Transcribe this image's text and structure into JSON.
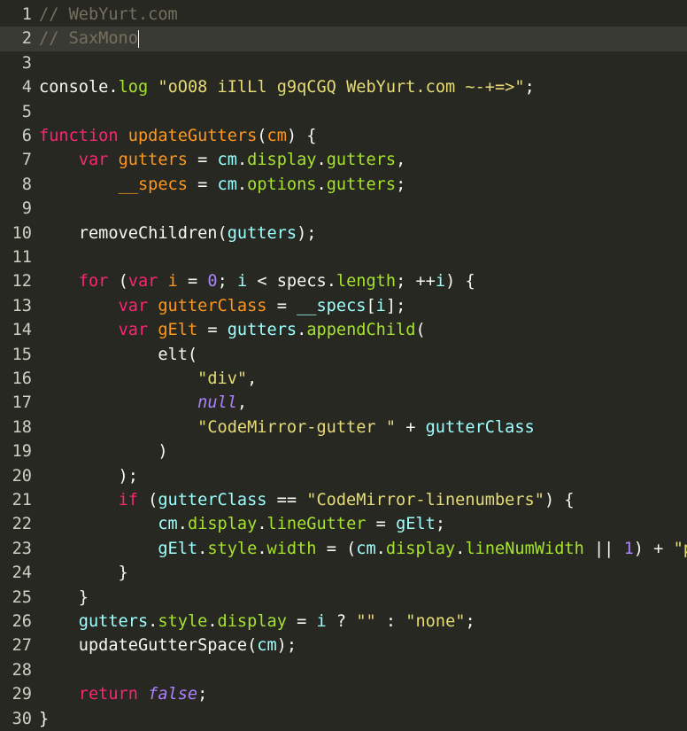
{
  "editor": {
    "lines": [
      {
        "n": "1",
        "tokens": [
          {
            "t": "// WebYurt.com",
            "c": "cmt"
          }
        ]
      },
      {
        "n": "2",
        "tokens": [
          {
            "t": "// SaxMono",
            "c": "cmt"
          }
        ],
        "active": true
      },
      {
        "n": "3",
        "tokens": []
      },
      {
        "n": "4",
        "tokens": [
          {
            "t": "console",
            "c": ""
          },
          {
            "t": ".",
            "c": ""
          },
          {
            "t": "log",
            "c": "prop"
          },
          {
            "t": " ",
            "c": ""
          },
          {
            "t": "\"oO08 iIlLl g9qCGQ WebYurt.com ~-+=>\"",
            "c": "str"
          },
          {
            "t": ";",
            "c": ""
          }
        ]
      },
      {
        "n": "5",
        "tokens": []
      },
      {
        "n": "6",
        "tokens": [
          {
            "t": "function",
            "c": "kw"
          },
          {
            "t": " ",
            "c": ""
          },
          {
            "t": "updateGutters",
            "c": "def"
          },
          {
            "t": "(",
            "c": ""
          },
          {
            "t": "cm",
            "c": "def"
          },
          {
            "t": ") {",
            "c": ""
          }
        ]
      },
      {
        "n": "7",
        "tokens": [
          {
            "t": "    ",
            "c": ""
          },
          {
            "t": "var",
            "c": "kw"
          },
          {
            "t": " ",
            "c": ""
          },
          {
            "t": "gutters",
            "c": "def"
          },
          {
            "t": " = ",
            "c": ""
          },
          {
            "t": "cm",
            "c": "var2"
          },
          {
            "t": ".",
            "c": ""
          },
          {
            "t": "display",
            "c": "prop"
          },
          {
            "t": ".",
            "c": ""
          },
          {
            "t": "gutters",
            "c": "prop"
          },
          {
            "t": ",",
            "c": ""
          }
        ]
      },
      {
        "n": "8",
        "tokens": [
          {
            "t": "        ",
            "c": ""
          },
          {
            "t": "__specs",
            "c": "def"
          },
          {
            "t": " = ",
            "c": ""
          },
          {
            "t": "cm",
            "c": "var2"
          },
          {
            "t": ".",
            "c": ""
          },
          {
            "t": "options",
            "c": "prop"
          },
          {
            "t": ".",
            "c": ""
          },
          {
            "t": "gutters",
            "c": "prop"
          },
          {
            "t": ";",
            "c": ""
          }
        ]
      },
      {
        "n": "9",
        "tokens": []
      },
      {
        "n": "10",
        "tokens": [
          {
            "t": "    removeChildren(",
            "c": ""
          },
          {
            "t": "gutters",
            "c": "var2"
          },
          {
            "t": ");",
            "c": ""
          }
        ]
      },
      {
        "n": "11",
        "tokens": []
      },
      {
        "n": "12",
        "tokens": [
          {
            "t": "    ",
            "c": ""
          },
          {
            "t": "for",
            "c": "kw"
          },
          {
            "t": " (",
            "c": ""
          },
          {
            "t": "var",
            "c": "kw"
          },
          {
            "t": " ",
            "c": ""
          },
          {
            "t": "i",
            "c": "def"
          },
          {
            "t": " = ",
            "c": ""
          },
          {
            "t": "0",
            "c": "num"
          },
          {
            "t": "; ",
            "c": ""
          },
          {
            "t": "i",
            "c": "var2"
          },
          {
            "t": " < specs.",
            "c": ""
          },
          {
            "t": "length",
            "c": "prop"
          },
          {
            "t": "; ++",
            "c": ""
          },
          {
            "t": "i",
            "c": "var2"
          },
          {
            "t": ") {",
            "c": ""
          }
        ]
      },
      {
        "n": "13",
        "tokens": [
          {
            "t": "        ",
            "c": ""
          },
          {
            "t": "var",
            "c": "kw"
          },
          {
            "t": " ",
            "c": ""
          },
          {
            "t": "gutterClass",
            "c": "def"
          },
          {
            "t": " = ",
            "c": ""
          },
          {
            "t": "__specs",
            "c": "var2"
          },
          {
            "t": "[",
            "c": ""
          },
          {
            "t": "i",
            "c": "var2"
          },
          {
            "t": "];",
            "c": ""
          }
        ]
      },
      {
        "n": "14",
        "tokens": [
          {
            "t": "        ",
            "c": ""
          },
          {
            "t": "var",
            "c": "kw"
          },
          {
            "t": " ",
            "c": ""
          },
          {
            "t": "gElt",
            "c": "def"
          },
          {
            "t": " = ",
            "c": ""
          },
          {
            "t": "gutters",
            "c": "var2"
          },
          {
            "t": ".",
            "c": ""
          },
          {
            "t": "appendChild",
            "c": "prop"
          },
          {
            "t": "(",
            "c": ""
          }
        ]
      },
      {
        "n": "15",
        "tokens": [
          {
            "t": "            elt(",
            "c": ""
          }
        ]
      },
      {
        "n": "16",
        "tokens": [
          {
            "t": "                ",
            "c": ""
          },
          {
            "t": "\"div\"",
            "c": "str"
          },
          {
            "t": ",",
            "c": ""
          }
        ]
      },
      {
        "n": "17",
        "tokens": [
          {
            "t": "                ",
            "c": ""
          },
          {
            "t": "null",
            "c": "atom"
          },
          {
            "t": ",",
            "c": ""
          }
        ]
      },
      {
        "n": "18",
        "tokens": [
          {
            "t": "                ",
            "c": ""
          },
          {
            "t": "\"CodeMirror-gutter \"",
            "c": "str"
          },
          {
            "t": " + ",
            "c": ""
          },
          {
            "t": "gutterClass",
            "c": "var2"
          }
        ]
      },
      {
        "n": "19",
        "tokens": [
          {
            "t": "            )",
            "c": ""
          }
        ]
      },
      {
        "n": "20",
        "tokens": [
          {
            "t": "        );",
            "c": ""
          }
        ]
      },
      {
        "n": "21",
        "tokens": [
          {
            "t": "        ",
            "c": ""
          },
          {
            "t": "if",
            "c": "kw"
          },
          {
            "t": " (",
            "c": ""
          },
          {
            "t": "gutterClass",
            "c": "var2"
          },
          {
            "t": " == ",
            "c": ""
          },
          {
            "t": "\"CodeMirror-linenumbers\"",
            "c": "str"
          },
          {
            "t": ") {",
            "c": ""
          }
        ]
      },
      {
        "n": "22",
        "tokens": [
          {
            "t": "            ",
            "c": ""
          },
          {
            "t": "cm",
            "c": "var2"
          },
          {
            "t": ".",
            "c": ""
          },
          {
            "t": "display",
            "c": "prop"
          },
          {
            "t": ".",
            "c": ""
          },
          {
            "t": "lineGutter",
            "c": "prop"
          },
          {
            "t": " = ",
            "c": ""
          },
          {
            "t": "gElt",
            "c": "var2"
          },
          {
            "t": ";",
            "c": ""
          }
        ]
      },
      {
        "n": "23",
        "tokens": [
          {
            "t": "            ",
            "c": ""
          },
          {
            "t": "gElt",
            "c": "var2"
          },
          {
            "t": ".",
            "c": ""
          },
          {
            "t": "style",
            "c": "prop"
          },
          {
            "t": ".",
            "c": ""
          },
          {
            "t": "width",
            "c": "prop"
          },
          {
            "t": " = (",
            "c": ""
          },
          {
            "t": "cm",
            "c": "var2"
          },
          {
            "t": ".",
            "c": ""
          },
          {
            "t": "display",
            "c": "prop"
          },
          {
            "t": ".",
            "c": ""
          },
          {
            "t": "lineNumWidth",
            "c": "prop"
          },
          {
            "t": " || ",
            "c": ""
          },
          {
            "t": "1",
            "c": "num"
          },
          {
            "t": ") + ",
            "c": ""
          },
          {
            "t": "\"px\"",
            "c": "str"
          },
          {
            "t": ";",
            "c": ""
          }
        ]
      },
      {
        "n": "24",
        "tokens": [
          {
            "t": "        }",
            "c": ""
          }
        ]
      },
      {
        "n": "25",
        "tokens": [
          {
            "t": "    }",
            "c": ""
          }
        ]
      },
      {
        "n": "26",
        "tokens": [
          {
            "t": "    ",
            "c": ""
          },
          {
            "t": "gutters",
            "c": "var2"
          },
          {
            "t": ".",
            "c": ""
          },
          {
            "t": "style",
            "c": "prop"
          },
          {
            "t": ".",
            "c": ""
          },
          {
            "t": "display",
            "c": "prop"
          },
          {
            "t": " = ",
            "c": ""
          },
          {
            "t": "i",
            "c": "var2"
          },
          {
            "t": " ? ",
            "c": ""
          },
          {
            "t": "\"\"",
            "c": "str"
          },
          {
            "t": " : ",
            "c": ""
          },
          {
            "t": "\"none\"",
            "c": "str"
          },
          {
            "t": ";",
            "c": ""
          }
        ]
      },
      {
        "n": "27",
        "tokens": [
          {
            "t": "    updateGutterSpace(",
            "c": ""
          },
          {
            "t": "cm",
            "c": "var2"
          },
          {
            "t": ");",
            "c": ""
          }
        ]
      },
      {
        "n": "28",
        "tokens": []
      },
      {
        "n": "29",
        "tokens": [
          {
            "t": "    ",
            "c": ""
          },
          {
            "t": "return",
            "c": "kw"
          },
          {
            "t": " ",
            "c": ""
          },
          {
            "t": "false",
            "c": "atom"
          },
          {
            "t": ";",
            "c": ""
          }
        ]
      },
      {
        "n": "30",
        "tokens": [
          {
            "t": "}",
            "c": ""
          }
        ]
      }
    ]
  }
}
